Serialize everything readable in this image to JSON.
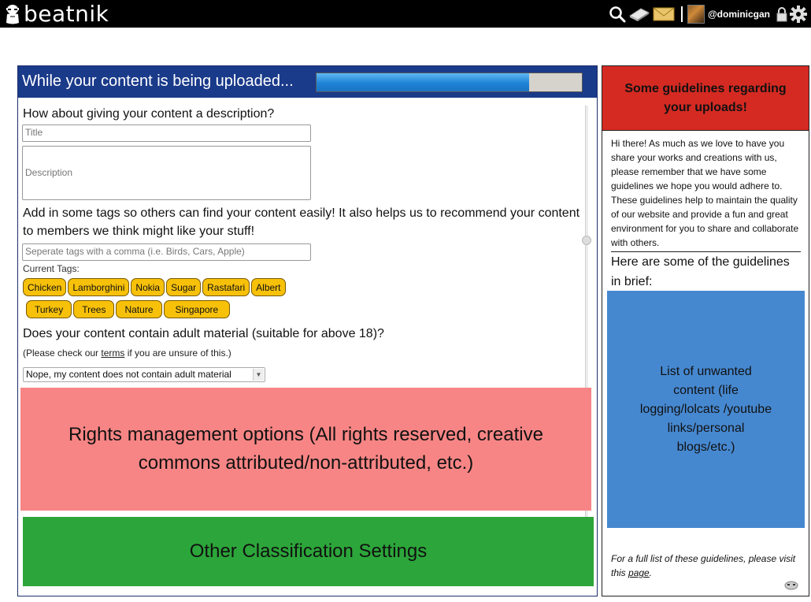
{
  "app": {
    "logo_text": "beatnik",
    "username": "@dominicgan"
  },
  "toolbar_icons": [
    "search-icon",
    "book-icon",
    "mail-icon",
    "avatar",
    "lock-icon",
    "gear-icon"
  ],
  "upload": {
    "title": "While your content is being uploaded...",
    "progress": 0.8
  },
  "form": {
    "description_question": "How about giving your content a description?",
    "title_placeholder": "Title",
    "description_placeholder": "Description",
    "tags_prompt": "Add in some tags so others can find your content easily! It also helps us to recommend your content to members we think might like your stuff!",
    "tags_placeholder": "Seperate tags with a comma (i.e. Birds, Cars, Apple)",
    "current_tags_label": "Current Tags:",
    "tags": [
      "Chicken",
      "Lamborghini",
      "Nokia",
      "Sugar",
      "Rastafari",
      "Albert",
      "Turkey",
      "Trees",
      "Nature",
      "Singapore"
    ],
    "adult_question": "Does your content contain adult material (suitable for above 18)?",
    "adult_note_prefix": "(Please check our ",
    "adult_note_link": "terms",
    "adult_note_suffix": " if you are unsure of this.)",
    "adult_select_value": "Nope, my content does not contain adult material",
    "rights_text": "Rights management options (All rights reserved, creative commons attributed/non-attributed, etc.)",
    "classification_text": "Other Classification Settings"
  },
  "sidebar": {
    "header": "Some guidelines regarding your uploads!",
    "intro": "Hi there! As much as we love to have you share your works and creations with us, please remember that we have some guidelines we hope you would adhere to. These guidelines help to maintain the quality of our website and provide a fun and great environment for you to share and collaborate with others.",
    "brief_heading": "Here are some of the guidelines in brief:",
    "list_text": "List of unwanted content (life logging/lolcats /youtube links/personal blogs/etc.)",
    "footnote_prefix": "For a full list of these guidelines, please visit this ",
    "footnote_link": "page",
    "footnote_suffix": "."
  },
  "colors": {
    "topbar": "#000000",
    "upload_header": "#1a3a8a",
    "progress_fill": "#1e83d6",
    "tag": "#f7c10a",
    "rights_box": "#f88585",
    "classification_box": "#2ca63a",
    "guide_header": "#d42a22",
    "list_box": "#4688d0"
  }
}
